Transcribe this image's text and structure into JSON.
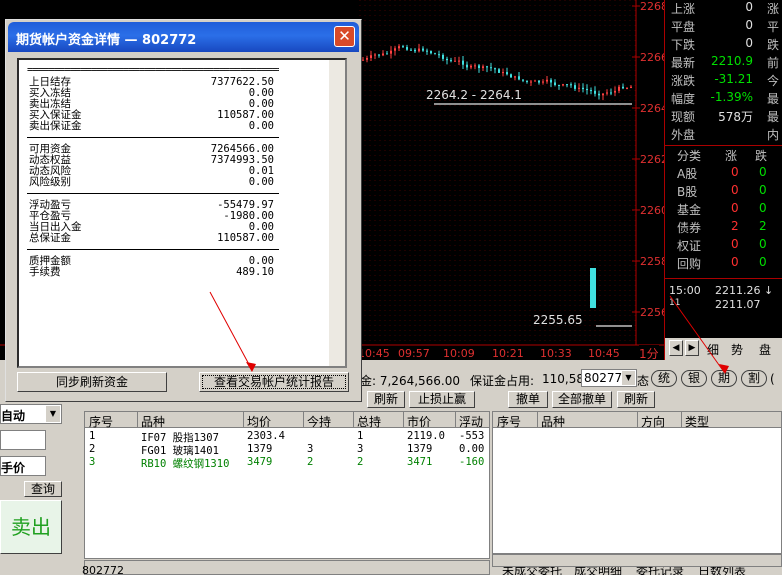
{
  "chart": {
    "price_labels": [
      "2268",
      "2266",
      "2264",
      "2262",
      "2260",
      "2258",
      "2256"
    ],
    "time_labels": [
      "10:45",
      "09:57",
      "10:09",
      "10:21",
      "10:33",
      "10:45"
    ],
    "period_label": "1分",
    "annotation_high": "2264.2 - 2264.1",
    "annotation_low": "2255.65"
  },
  "info": {
    "rows": [
      {
        "k": "上涨",
        "v": "0",
        "c": "涨",
        "vc": "wht"
      },
      {
        "k": "平盘",
        "v": "0",
        "c": "平",
        "vc": "wht"
      },
      {
        "k": "下跌",
        "v": "0",
        "c": "跌",
        "vc": "wht"
      },
      {
        "k": "最新",
        "v": "2210.9",
        "c": "前",
        "vc": "grn"
      },
      {
        "k": "涨跌",
        "v": "-31.21",
        "c": "今",
        "vc": "grn"
      },
      {
        "k": "幅度",
        "v": "-1.39%",
        "c": "最",
        "vc": "grn"
      },
      {
        "k": "现额",
        "v": "578万",
        "c": "最",
        "vc": "wht"
      },
      {
        "k": "外盘",
        "v": "",
        "c": "内",
        "vc": "wht"
      }
    ],
    "table_headers": [
      "分类",
      "涨",
      "跌"
    ],
    "table_rows": [
      {
        "k": "A股",
        "a": "0",
        "b": "0"
      },
      {
        "k": "B股",
        "a": "0",
        "b": "0"
      },
      {
        "k": "基金",
        "a": "0",
        "b": "0"
      },
      {
        "k": "债券",
        "a": "2",
        "b": "2"
      },
      {
        "k": "权证",
        "a": "0",
        "b": "0"
      },
      {
        "k": "回购",
        "a": "0",
        "b": "0"
      }
    ],
    "ticks": [
      {
        "t": "15:00",
        "p": "2211.26 ↓"
      },
      {
        "t": "11",
        "p": "2211.07"
      }
    ],
    "bottom_tabs": [
      "细",
      "势",
      "盘"
    ]
  },
  "statusbar": {
    "funds_text": "金: 7,264,566.00",
    "margin_label": "保证金占用:",
    "margin_value": "110,58",
    "account": "802772",
    "market_buttons": [
      "统",
      "银",
      "期",
      "割"
    ]
  },
  "left_panel": {
    "mode": "自动",
    "price_mode": "手价",
    "query": "查询",
    "sell": "卖出"
  },
  "positions": {
    "toolbar": [
      "刷新",
      "止损止赢"
    ],
    "headers": [
      "序号",
      "品种",
      "均价",
      "今持",
      "总持",
      "市价",
      "浮动"
    ],
    "rows": [
      {
        "no": "1",
        "sym": "IF07 股指1307",
        "avg": "2303.4",
        "today": "",
        "total": "1",
        "mkt": "2119.0",
        "pnl": "-553",
        "color": "#000"
      },
      {
        "no": "2",
        "sym": "FG01 玻璃1401",
        "avg": "1379",
        "today": "3",
        "total": "3",
        "mkt": "1379",
        "pnl": "0.00",
        "color": "#000"
      },
      {
        "no": "3",
        "sym": "RB10 螺纹钢1310",
        "avg": "3479",
        "today": "2",
        "total": "2",
        "mkt": "3471",
        "pnl": "-160",
        "color": "#008000"
      }
    ]
  },
  "orders": {
    "toolbar": [
      "撤单",
      "全部撤单",
      "刷新"
    ],
    "headers": [
      "序号",
      "品种",
      "方向",
      "类型"
    ],
    "bottom_tabs": [
      "未成交委托",
      "成交明细",
      "委托记录",
      "日数列表"
    ]
  },
  "bottom_account": "802772",
  "dialog": {
    "title": "期货帐户资金详情 — 802772",
    "separator": "================================================",
    "groups": [
      [
        {
          "l": "上日结存",
          "r": "7377622.50"
        },
        {
          "l": "买入冻结",
          "r": "0.00"
        },
        {
          "l": "卖出冻结",
          "r": "0.00"
        },
        {
          "l": "买入保证金",
          "r": "110587.00"
        },
        {
          "l": "卖出保证金",
          "r": "0.00"
        }
      ],
      [
        {
          "l": "可用资金",
          "r": "7264566.00"
        },
        {
          "l": "动态权益",
          "r": "7374993.50"
        },
        {
          "l": "动态风险",
          "r": "0.01"
        },
        {
          "l": "风险级别",
          "r": "0.00"
        }
      ],
      [
        {
          "l": "浮动盈亏",
          "r": "-55479.97"
        },
        {
          "l": "平仓盈亏",
          "r": "-1980.00"
        },
        {
          "l": "当日出入金",
          "r": "0.00"
        },
        {
          "l": "总保证金",
          "r": "110587.00"
        }
      ],
      [
        {
          "l": "质押金额",
          "r": "0.00"
        },
        {
          "l": "手续费",
          "r": "489.10"
        }
      ]
    ],
    "sync_button": "同步刷新资金",
    "report_button": "查看交易帐户统计报告"
  }
}
